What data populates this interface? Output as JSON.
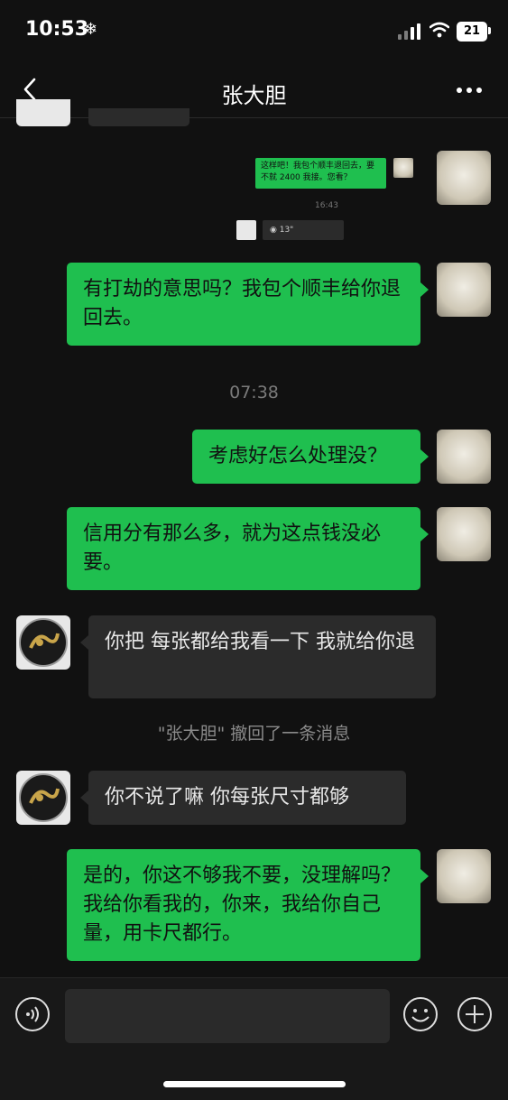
{
  "status_bar": {
    "time": "10:53",
    "battery": "21"
  },
  "header": {
    "title": "张大胆"
  },
  "quoted_screenshot": {
    "message": "这样吧！我包个顺丰退回去，要不就 2400 我接。您看？",
    "time": "16:43",
    "voice_duration": "13\""
  },
  "messages": [
    {
      "side": "out",
      "text": "有打劫的意思吗？我包个顺丰给你退回去。"
    },
    {
      "kind": "timestamp",
      "text": "07:38"
    },
    {
      "side": "out",
      "text": "考虑好怎么处理没？"
    },
    {
      "side": "out",
      "text": "信用分有那么多，就为这点钱没必要。"
    },
    {
      "side": "in",
      "text": "你把 每张都给我看一下  我就给你退"
    },
    {
      "kind": "system",
      "text": "\"张大胆\" 撤回了一条消息"
    },
    {
      "side": "in",
      "text": "你不说了嘛  你每张尺寸都够"
    },
    {
      "side": "out",
      "text": "是的，你这不够我不要，没理解吗？我给你看我的，你来，我给你自己量，用卡尺都行。"
    }
  ],
  "icons": {
    "back": "chevron-left-icon",
    "more": "more-dots-icon",
    "voice": "voice-input-icon",
    "emoji": "emoji-icon",
    "plus": "plus-icon"
  },
  "colors": {
    "outgoing_bubble": "#1fbf4f",
    "incoming_bubble": "#2b2b2b",
    "background": "#111111"
  }
}
